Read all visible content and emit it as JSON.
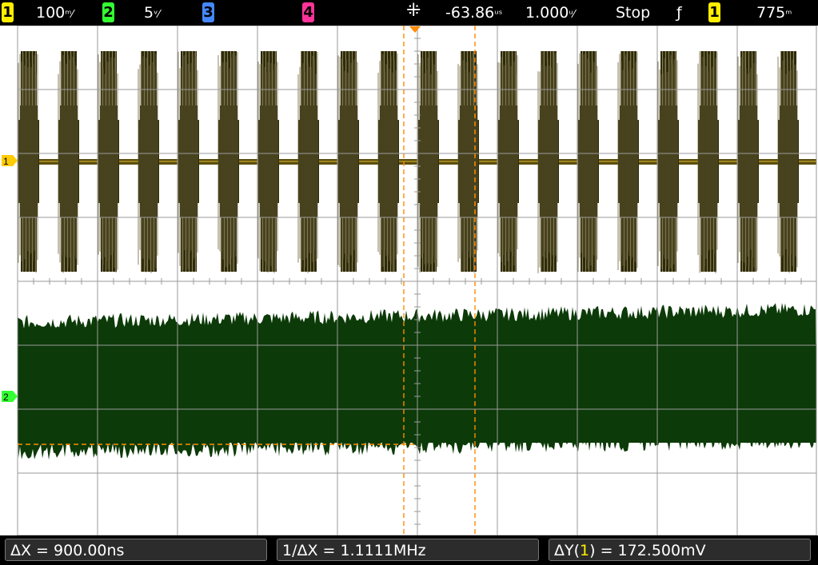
{
  "top_bar": {
    "ch1_number": "1",
    "ch1_scale": "100",
    "ch2_number": "2",
    "ch2_scale": "5",
    "ch3_number": "3",
    "ch4_number": "4",
    "trigger_delay": "-63.86",
    "time_scale": "1.000",
    "run_state": "Stop",
    "trigger_source": "1",
    "trigger_level": "775"
  },
  "channel_markers": {
    "ch1": "1",
    "ch2": "2"
  },
  "measurements": {
    "delta_x": "ΔX = 900.00ns",
    "inverse_delta_x": "1/ΔX = 1.1111MHz",
    "delta_y_prefix": "ΔY(",
    "delta_y_channel": "1",
    "delta_y_suffix": ") = 172.500mV"
  },
  "colors": {
    "ch1": "#ffee00",
    "ch2": "#33ff33",
    "ch3": "#4488ff",
    "ch4": "#ff3399",
    "ch1_trace": "#2e2b08",
    "ch2_trace": "#0c3a08",
    "cursor": "#ff8c00"
  }
}
